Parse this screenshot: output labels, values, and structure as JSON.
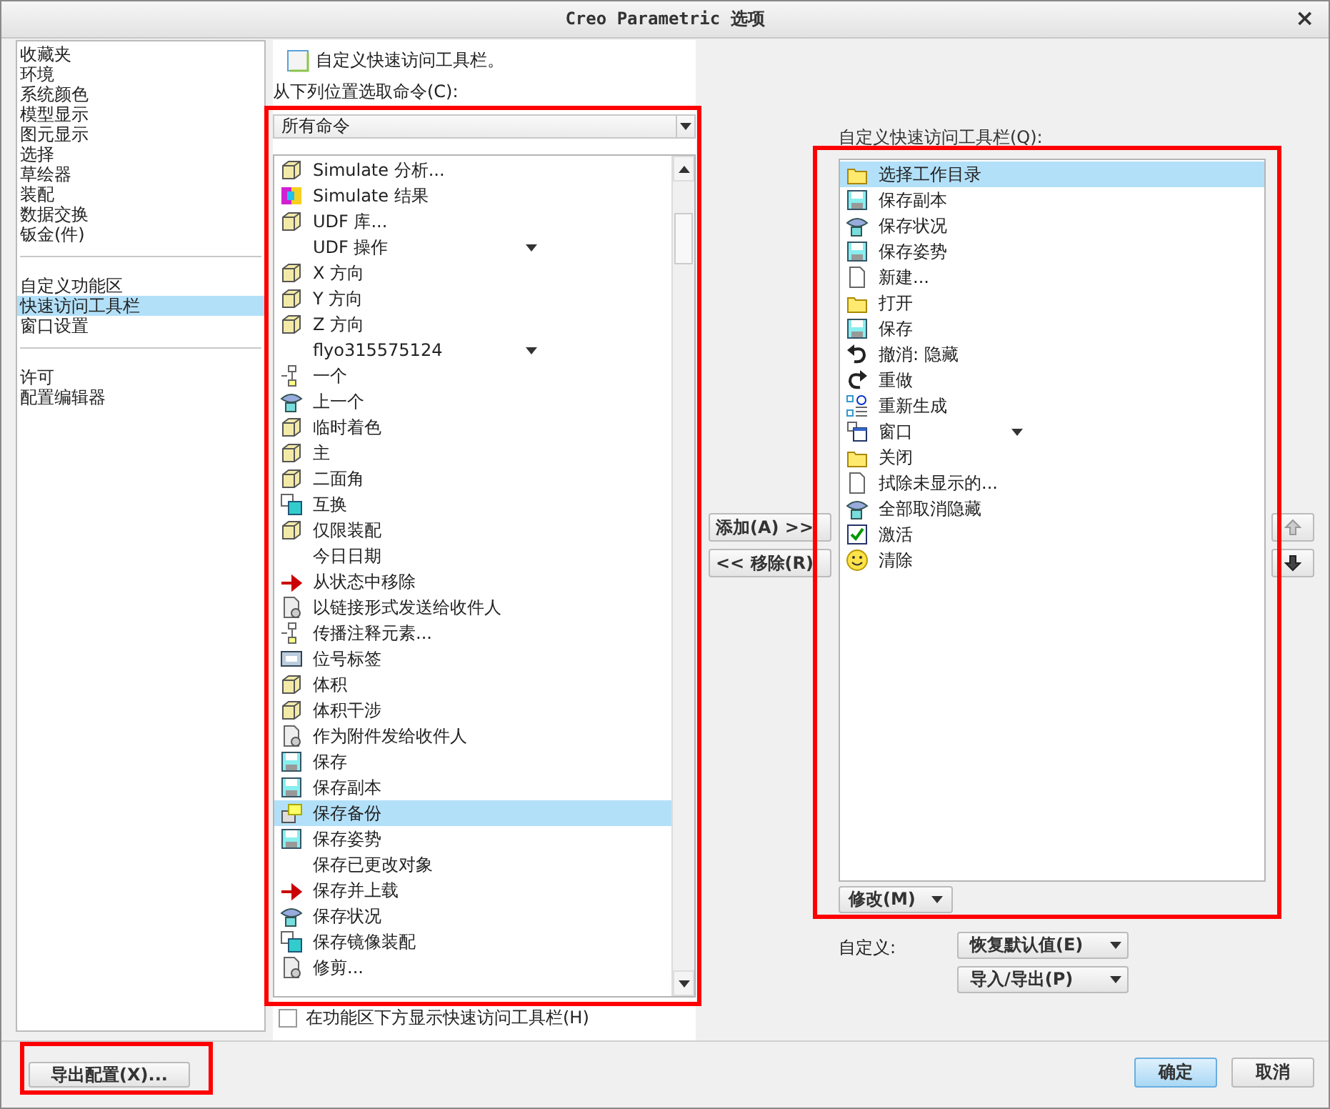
{
  "window": {
    "title": "Creo Parametric 选项",
    "close": "×"
  },
  "nav": {
    "groups": [
      {
        "items": [
          {
            "label": "收藏夹",
            "selected": false
          },
          {
            "label": "环境",
            "selected": false
          },
          {
            "label": "系统颜色",
            "selected": false
          },
          {
            "label": "模型显示",
            "selected": false
          },
          {
            "label": "图元显示",
            "selected": false
          },
          {
            "label": "选择",
            "selected": false
          },
          {
            "label": "草绘器",
            "selected": false
          },
          {
            "label": "装配",
            "selected": false
          },
          {
            "label": "数据交换",
            "selected": false
          },
          {
            "label": "钣金(件)",
            "selected": false
          }
        ]
      },
      {
        "items": [
          {
            "label": "自定义功能区",
            "selected": false
          },
          {
            "label": "快速访问工具栏",
            "selected": true
          },
          {
            "label": "窗口设置",
            "selected": false
          }
        ]
      },
      {
        "items": [
          {
            "label": "许可",
            "selected": false
          },
          {
            "label": "配置编辑器",
            "selected": false
          }
        ]
      }
    ]
  },
  "heading": {
    "text": "自定义快速访问工具栏。"
  },
  "source": {
    "label": "从下列位置选取命令(C):",
    "dropdown": "所有命令",
    "highlighted": true,
    "items": [
      {
        "label": "Simulate 分析...",
        "icon": true,
        "menu": false,
        "selected": false
      },
      {
        "label": "Simulate 结果",
        "icon": true,
        "menu": false,
        "selected": false
      },
      {
        "label": "UDF 库...",
        "icon": true,
        "menu": false,
        "selected": false
      },
      {
        "label": "UDF 操作",
        "icon": false,
        "menu": true,
        "selected": false
      },
      {
        "label": "X 方向",
        "icon": true,
        "menu": false,
        "selected": false
      },
      {
        "label": "Y 方向",
        "icon": true,
        "menu": false,
        "selected": false
      },
      {
        "label": "Z 方向",
        "icon": true,
        "menu": false,
        "selected": false
      },
      {
        "label": "flyo315575124",
        "icon": false,
        "menu": true,
        "selected": false
      },
      {
        "label": "一个",
        "icon": true,
        "menu": false,
        "selected": false
      },
      {
        "label": "上一个",
        "icon": true,
        "menu": false,
        "selected": false
      },
      {
        "label": "临时着色",
        "icon": true,
        "menu": false,
        "selected": false
      },
      {
        "label": "主",
        "icon": true,
        "menu": false,
        "selected": false
      },
      {
        "label": "二面角",
        "icon": true,
        "menu": false,
        "selected": false
      },
      {
        "label": "互换",
        "icon": true,
        "menu": false,
        "selected": false
      },
      {
        "label": "仅限装配",
        "icon": true,
        "menu": false,
        "selected": false
      },
      {
        "label": "今日日期",
        "icon": false,
        "menu": false,
        "selected": false
      },
      {
        "label": "从状态中移除",
        "icon": true,
        "menu": false,
        "selected": false
      },
      {
        "label": "以链接形式发送给收件人",
        "icon": true,
        "menu": false,
        "selected": false
      },
      {
        "label": "传播注释元素...",
        "icon": true,
        "menu": false,
        "selected": false
      },
      {
        "label": "位号标签",
        "icon": true,
        "menu": false,
        "selected": false
      },
      {
        "label": "体积",
        "icon": true,
        "menu": false,
        "selected": false
      },
      {
        "label": "体积干涉",
        "icon": true,
        "menu": false,
        "selected": false
      },
      {
        "label": "作为附件发给收件人",
        "icon": true,
        "menu": false,
        "selected": false
      },
      {
        "label": "保存",
        "icon": true,
        "menu": false,
        "selected": false
      },
      {
        "label": "保存副本",
        "icon": true,
        "menu": false,
        "selected": false
      },
      {
        "label": "保存备份",
        "icon": true,
        "menu": false,
        "selected": true
      },
      {
        "label": "保存姿势",
        "icon": true,
        "menu": false,
        "selected": false
      },
      {
        "label": "保存已更改对象",
        "icon": false,
        "menu": false,
        "selected": false
      },
      {
        "label": "保存并上载",
        "icon": true,
        "menu": false,
        "selected": false
      },
      {
        "label": "保存状况",
        "icon": true,
        "menu": false,
        "selected": false
      },
      {
        "label": "保存镜像装配",
        "icon": true,
        "menu": false,
        "selected": false
      },
      {
        "label": "修剪...",
        "icon": true,
        "menu": false,
        "selected": false
      }
    ]
  },
  "show_below": {
    "label": "在功能区下方显示快速访问工具栏(H)",
    "checked": false
  },
  "transfer_buttons": [
    "添加(A) >>",
    "<< 移除(R)"
  ],
  "toolbar": {
    "label": "自定义快速访问工具栏(Q):",
    "highlighted": true,
    "modify_button": "修改(M)",
    "items": [
      {
        "label": "选择工作目录",
        "menu": false,
        "selected": true
      },
      {
        "label": "保存副本",
        "menu": false,
        "selected": false
      },
      {
        "label": "保存状况",
        "menu": false,
        "selected": false
      },
      {
        "label": "保存姿势",
        "menu": false,
        "selected": false
      },
      {
        "label": "新建...",
        "menu": false,
        "selected": false
      },
      {
        "label": "打开",
        "menu": false,
        "selected": false
      },
      {
        "label": "保存",
        "menu": false,
        "selected": false
      },
      {
        "label": "撤消:  隐藏",
        "menu": false,
        "selected": false
      },
      {
        "label": "重做",
        "menu": false,
        "selected": false
      },
      {
        "label": "重新生成",
        "menu": false,
        "selected": false
      },
      {
        "label": "窗口",
        "menu": true,
        "selected": false
      },
      {
        "label": "关闭",
        "menu": false,
        "selected": false
      },
      {
        "label": "拭除未显示的...",
        "menu": false,
        "selected": false
      },
      {
        "label": "全部取消隐藏",
        "menu": false,
        "selected": false
      },
      {
        "label": "激活",
        "menu": false,
        "selected": false
      },
      {
        "label": "清除",
        "menu": false,
        "selected": false
      }
    ]
  },
  "customize": {
    "label": "自定义:",
    "buttons": [
      "恢复默认值(E)",
      "导入/导出(P)"
    ]
  },
  "export_button": {
    "label": "导出配置(X)...",
    "highlighted": true
  },
  "footer_buttons": [
    {
      "label": "确定",
      "primary": true
    },
    {
      "label": "取消",
      "primary": false
    }
  ]
}
